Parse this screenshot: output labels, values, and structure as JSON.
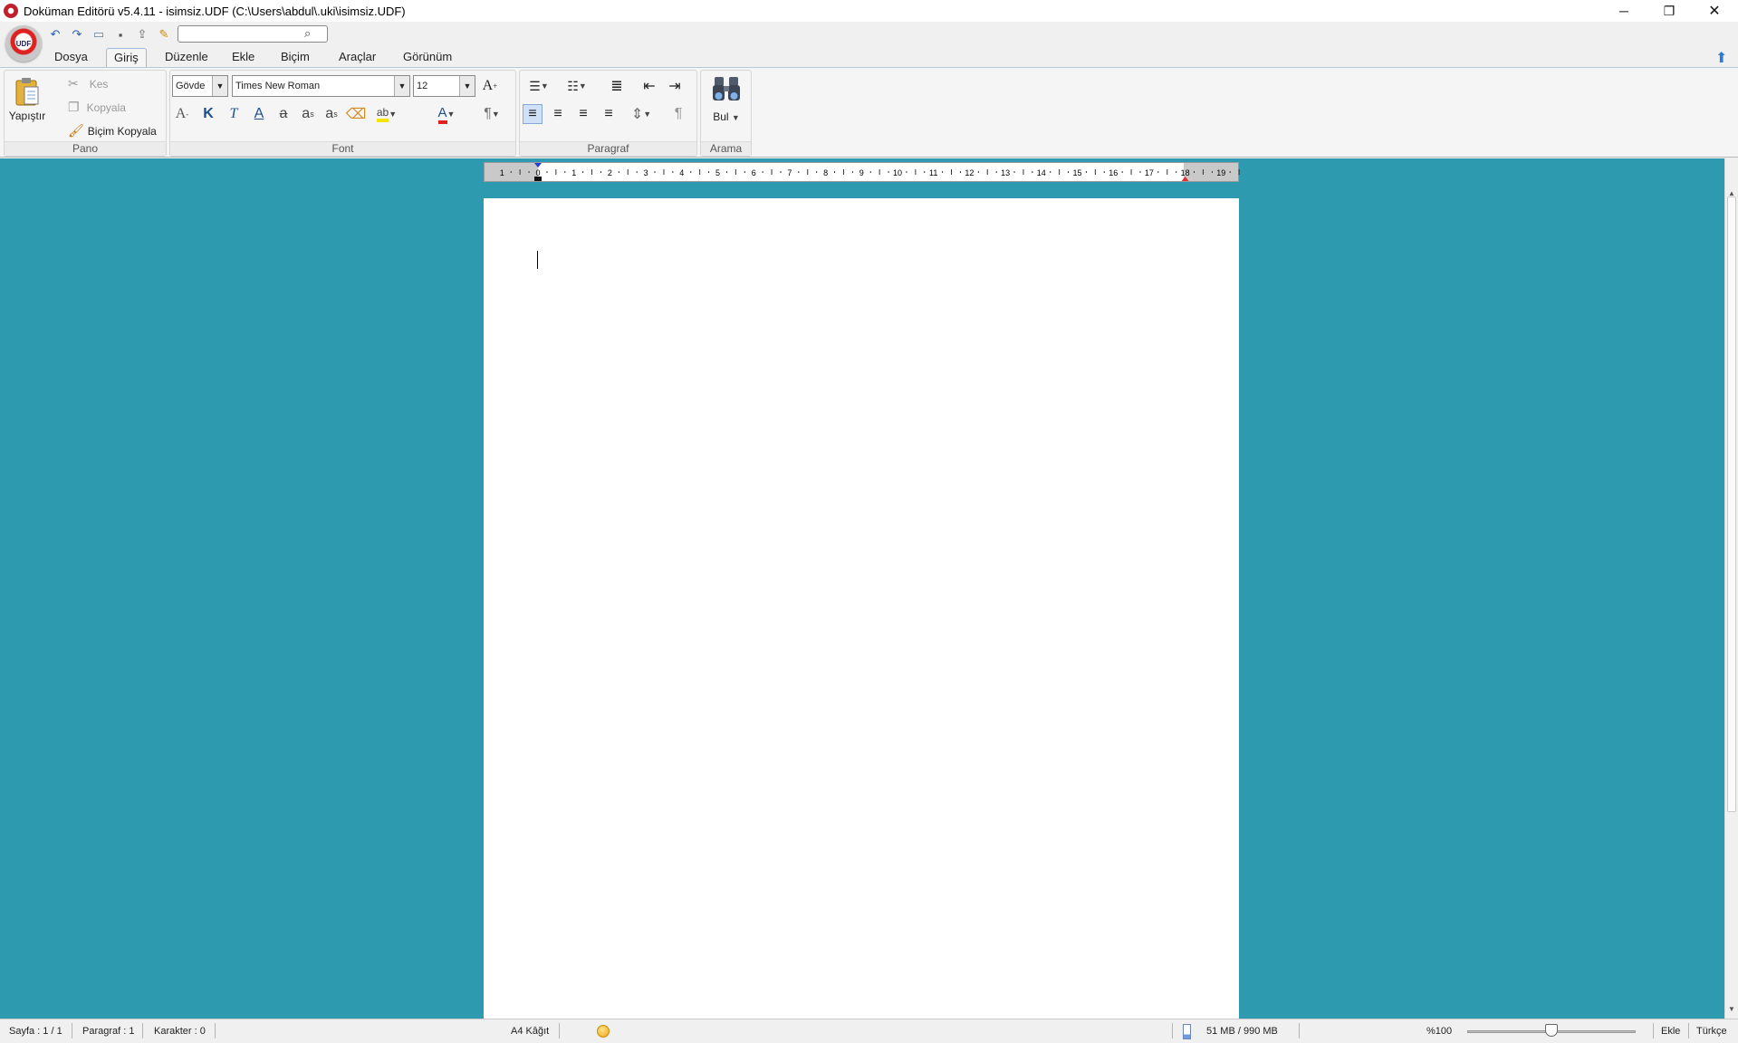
{
  "window": {
    "title": "Doküman Editörü v5.4.11 - isimsiz.UDF (C:\\Users\\abdul\\.uki\\isimsiz.UDF)",
    "min_glyph": "─",
    "max_glyph": "❐",
    "close_glyph": "✕"
  },
  "app_orb_label": "UDF",
  "quick_access": {
    "search_value": "",
    "icons": [
      "undo-icon",
      "redo-icon",
      "open-folder-icon",
      "save-icon",
      "export-icon",
      "edit-icon",
      "search-icon"
    ]
  },
  "tabs": [
    {
      "label": "Dosya",
      "active": false
    },
    {
      "label": "Giriş",
      "active": true
    },
    {
      "label": "Düzenle",
      "active": false
    },
    {
      "label": "Ekle",
      "active": false
    },
    {
      "label": "Biçim",
      "active": false
    },
    {
      "label": "Araçlar",
      "active": false
    },
    {
      "label": "Görünüm",
      "active": false
    }
  ],
  "ribbon": {
    "pano": {
      "label": "Pano",
      "paste": "Yapıştır",
      "cut": "Kes",
      "copy": "Kopyala",
      "format_painter": "Biçim Kopyala"
    },
    "font": {
      "label": "Font",
      "style_value": "Gövde",
      "font_value": "Times New Roman",
      "size_value": "12"
    },
    "paragraf": {
      "label": "Paragraf"
    },
    "arama": {
      "label": "Arama",
      "find": "Bul"
    }
  },
  "ruler": {
    "labels": [
      "1",
      "0",
      "1",
      "2",
      "3",
      "4",
      "5",
      "6",
      "7",
      "8",
      "9",
      "10",
      "11",
      "12",
      "13",
      "14",
      "15",
      "16",
      "17",
      "18",
      "19"
    ]
  },
  "status": {
    "page": "Sayfa : 1 / 1",
    "paragraph": "Paragraf : 1",
    "characters": "Karakter : 0",
    "paper": "A4 Kâğıt",
    "memory": "51 MB / 990 MB",
    "zoom": "%100",
    "zoom_fraction": 0.5,
    "mode": "Ekle",
    "language": "Türkçe"
  },
  "colors": {
    "workspace": "#2e9aaf",
    "accent": "#2b7bd0"
  }
}
